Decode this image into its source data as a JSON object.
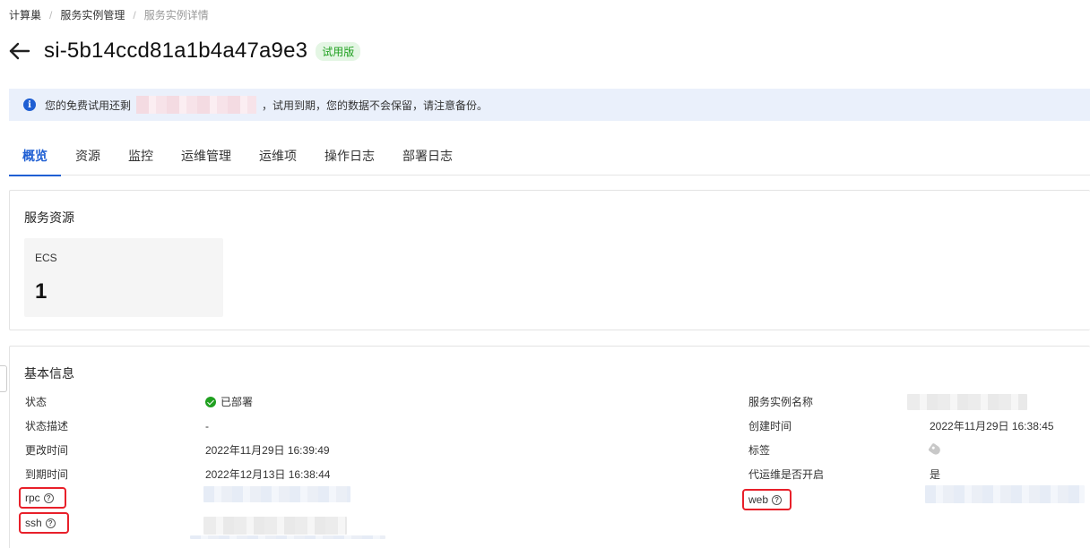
{
  "breadcrumb": {
    "items": [
      "计算巢",
      "服务实例管理",
      "服务实例详情"
    ],
    "separator": "/"
  },
  "header": {
    "title": "si-5b14ccd81a1b4a47a9e3",
    "badge": "试用版",
    "back_icon": "arrow-left-icon"
  },
  "notice": {
    "icon": "info-icon",
    "icon_glyph": "i",
    "prefix": "您的免费试用还剩",
    "suffix": "，试用到期，您的数据不会保留，请注意备份。"
  },
  "tabs": [
    {
      "label": "概览",
      "active": true
    },
    {
      "label": "资源",
      "active": false
    },
    {
      "label": "监控",
      "active": false
    },
    {
      "label": "运维管理",
      "active": false
    },
    {
      "label": "运维项",
      "active": false
    },
    {
      "label": "操作日志",
      "active": false
    },
    {
      "label": "部署日志",
      "active": false
    }
  ],
  "resources": {
    "title": "服务资源",
    "metric_label": "ECS",
    "metric_value": "1"
  },
  "basic_info": {
    "title": "基本信息",
    "left": [
      {
        "label": "状态",
        "value": "已部署"
      },
      {
        "label": "状态描述",
        "value": "-"
      },
      {
        "label": "更改时间",
        "value": "2022年11月29日 16:39:49"
      },
      {
        "label": "到期时间",
        "value": "2022年12月13日 16:38:44"
      },
      {
        "label": "rpc",
        "value": ""
      },
      {
        "label": "ssh",
        "value": ""
      }
    ],
    "right": [
      {
        "label": "服务实例名称",
        "value": ""
      },
      {
        "label": "创建时间",
        "value": "2022年11月29日 16:38:45"
      },
      {
        "label": "标签",
        "value": ""
      },
      {
        "label": "代运维是否开启",
        "value": "是"
      },
      {
        "label": "web",
        "value": ""
      }
    ],
    "help_glyph": "?",
    "highlight_color": "#e8202a",
    "status_color": "#20a020"
  },
  "colors": {
    "accent": "#1f5fd3",
    "notice_bg": "#eaf0fb",
    "badge_bg": "#e4f6e4",
    "badge_text": "#20a020"
  }
}
